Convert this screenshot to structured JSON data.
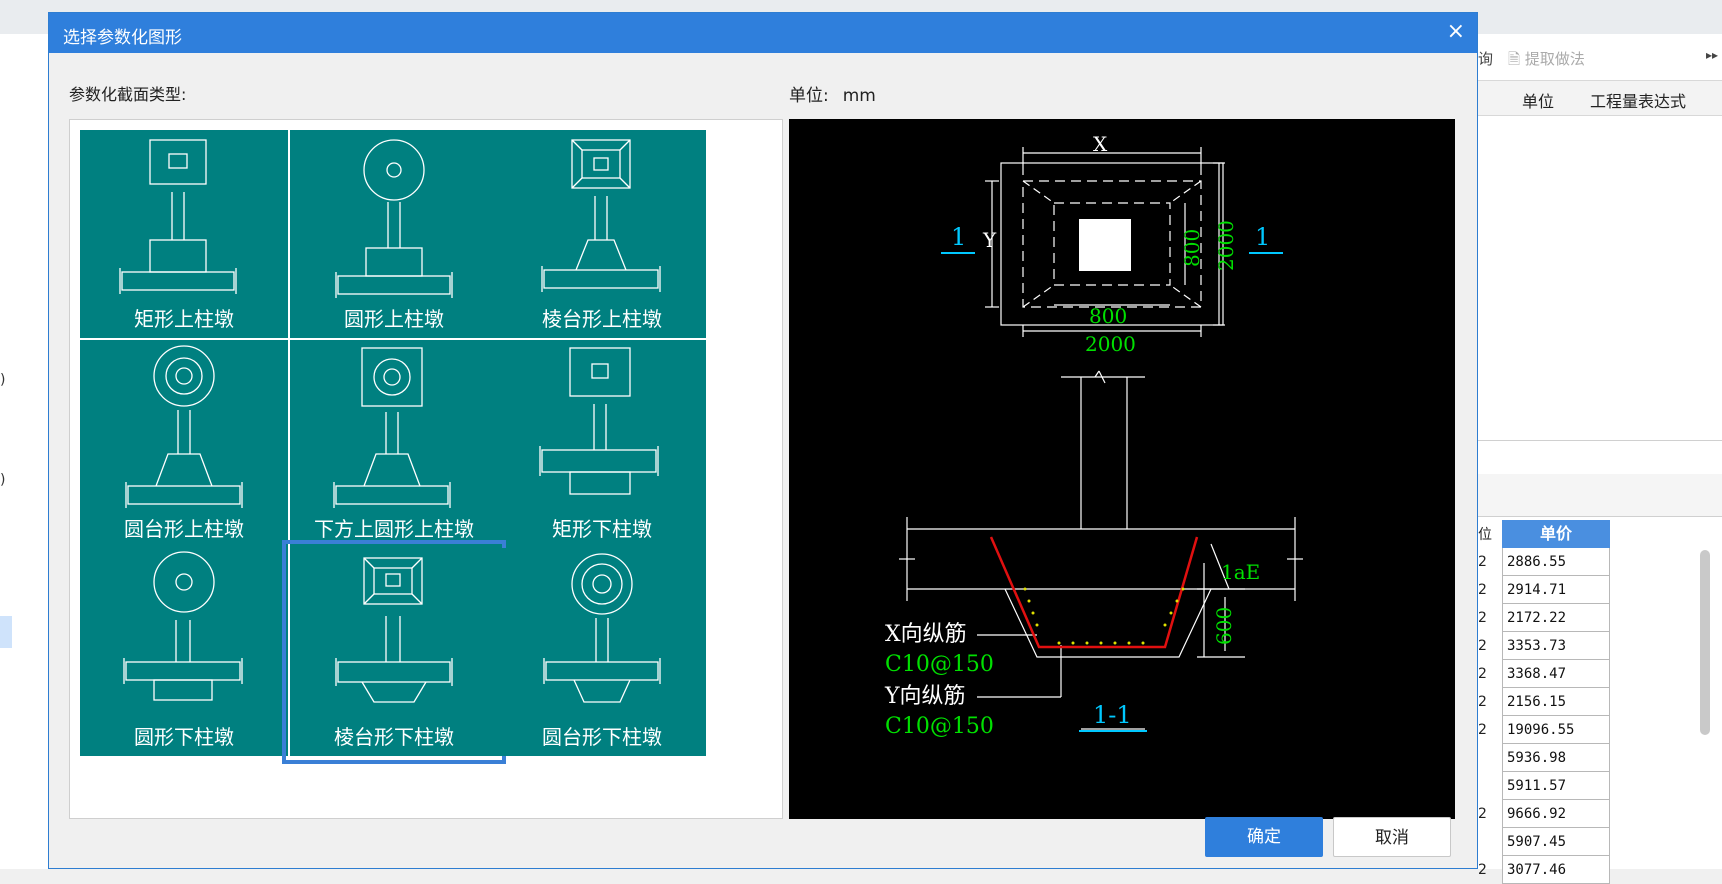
{
  "dialog": {
    "title": "选择参数化图形",
    "close_glyph": "×",
    "section_label": "参数化截面类型:",
    "unit_label": "单位:",
    "unit_value": "mm",
    "ok_label": "确定",
    "cancel_label": "取消",
    "accent_color": "#2f7fdc",
    "tile_color": "#008080"
  },
  "tiles": [
    {
      "label": "矩形上柱墩"
    },
    {
      "label": "圆形上柱墩"
    },
    {
      "label": "棱台形上柱墩"
    },
    {
      "label": "圆台形上柱墩"
    },
    {
      "label": "下方上圆形上柱墩"
    },
    {
      "label": "矩形下柱墩"
    },
    {
      "label": "圆形下柱墩"
    },
    {
      "label": "棱台形下柱墩",
      "selected": true
    },
    {
      "label": "圆台形下柱墩"
    }
  ],
  "preview": {
    "dim_x": "X",
    "dim_y": "Y",
    "dim_inner_w": "800",
    "dim_outer_w": "2000",
    "dim_inner_h": "800",
    "dim_outer_h": "2000",
    "section_mark": "1",
    "anchor_label": "1aE",
    "depth_label": "600",
    "x_rebar_label": "X向纵筋",
    "x_rebar_value": "C10@150",
    "y_rebar_label": "Y向纵筋",
    "y_rebar_value": "C10@150",
    "section_title": "1-1"
  },
  "background": {
    "toolbar_query": "询",
    "toolbar_extract": "提取做法",
    "toolbar_more": "▸▸",
    "col_unit": "单位",
    "col_expression": "工程量表达式",
    "price_header": "单价",
    "price_unit_header": "位",
    "prices": [
      "2886.55",
      "2914.71",
      "2172.22",
      "3353.73",
      "3368.47",
      "2156.15",
      "19096.55",
      "5936.98",
      "5911.57",
      "9666.92",
      "5907.45",
      "3077.46"
    ],
    "price_units": [
      "2",
      "2",
      "2",
      "2",
      "2",
      "2",
      "2",
      "",
      "",
      "2",
      "",
      "2"
    ],
    "left_marks": [
      ")",
      ")"
    ]
  }
}
